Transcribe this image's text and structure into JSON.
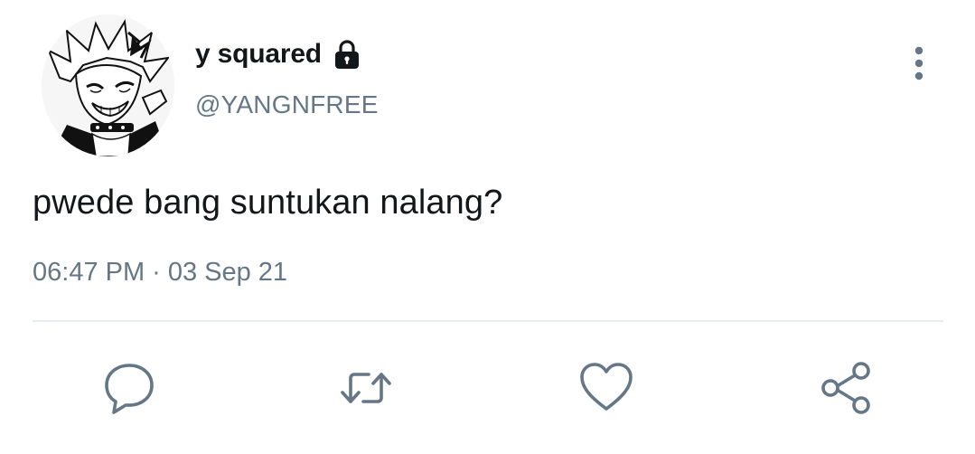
{
  "author": {
    "display_name": "y squared",
    "handle": "@YANGNFREE",
    "protected_icon": "lock-icon",
    "avatar": "avatar-illustration"
  },
  "tweet": {
    "text": "pwede bang suntukan nalang?",
    "time": "06:47 PM",
    "separator": "·",
    "date": "03 Sep 21"
  },
  "actions": {
    "reply": "reply-icon",
    "retweet": "retweet-icon",
    "like": "heart-icon",
    "share": "share-icon"
  },
  "menu": {
    "more": "more-vertical-icon"
  },
  "colors": {
    "text": "#14171a",
    "secondary": "#657786",
    "icon": "#657786",
    "divider": "#e6ecf0"
  }
}
